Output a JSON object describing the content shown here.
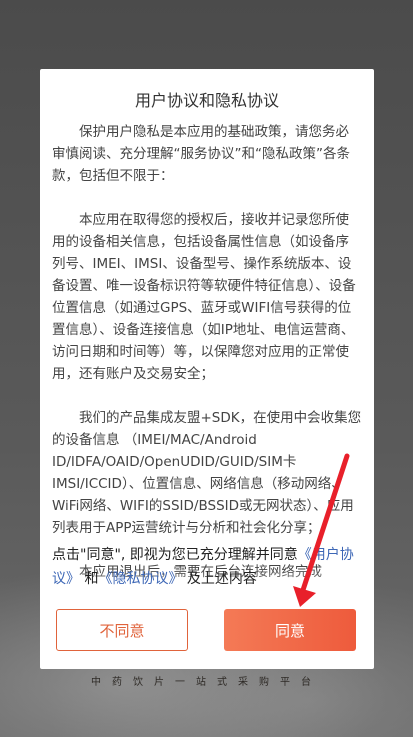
{
  "tagline": "中药饮片一站式采购平台",
  "dialog": {
    "title": "用户协议和隐私协议",
    "paragraphs": [
      "保护用户隐私是本应用的基础政策，请您务必审慎阅读、充分理解“服务协议”和“隐私政策”各条款，包括但不限于：",
      "本应用在取得您的授权后，接收并记录您所使用的设备相关信息，包括设备属性信息（如设备序列号、IMEI、IMSI、设备型号、操作系统版本、设备设置、唯一设备标识符等软硬件特征信息）、设备位置信息（如通过GPS、蓝牙或WIFI信号获得的位置信息）、设备连接信息（如IP地址、电信运营商、访问日期和时间等）等，以保障您对应用的正常使用，还有账户及交易安全；",
      "我们的产品集成友盟+SDK，在使用中会收集您的设备信息 （IMEI/MAC/Android ID/IDFA/OAID/OpenUDID/GUID/SIM卡IMSI/ICCID）、位置信息、网络信息（移动网络、WiFi网络、WIFI的SSID/BSSID或无网状态）、应用列表用于APP运营统计与分析和社会化分享；",
      "本应用退出后，需要在后台连接网络完成"
    ],
    "consent": {
      "prefix": "点击\"同意\", 即视为您已充分理解并同意",
      "user_agreement_link": "《用户协议》",
      "and": "和",
      "privacy_link": "《隐私协议》",
      "suffix": "及上述内容"
    },
    "buttons": {
      "disagree": "不同意",
      "agree": "同意"
    }
  },
  "colors": {
    "accent": "#ee5b3c",
    "link": "#3d67b6",
    "arrow": "#e8202a"
  }
}
